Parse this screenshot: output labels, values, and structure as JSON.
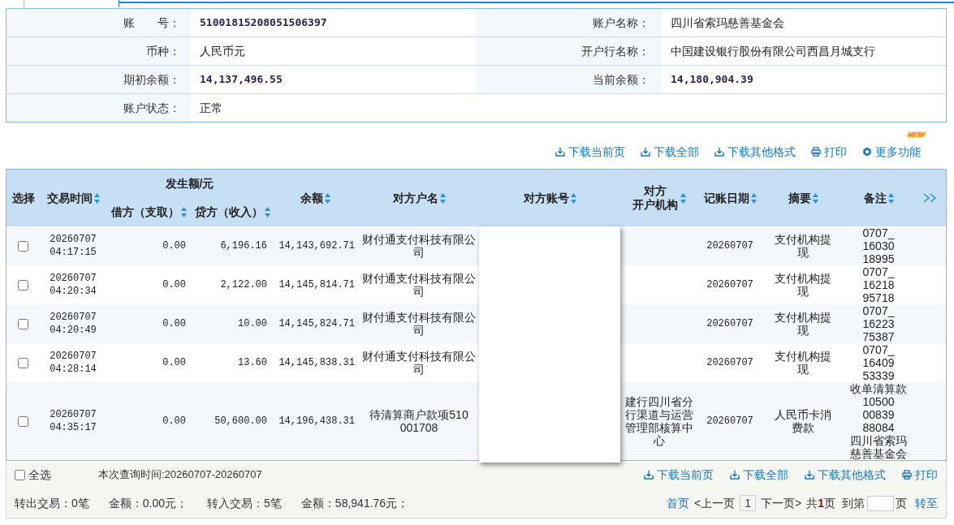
{
  "account_info": {
    "fields": [
      {
        "label": "账　　号：",
        "value": "51001815208051506397",
        "kind": "figure"
      },
      {
        "label": "账户名称：",
        "value": "四川省索玛慈善基金会",
        "kind": "text"
      },
      {
        "label": "币种：",
        "value": "人民币元",
        "kind": "text"
      },
      {
        "label": "开户行名称：",
        "value": "中国建设银行股份有限公司西昌月城支行",
        "kind": "text"
      },
      {
        "label": "期初余额：",
        "value": "14,137,496.55",
        "kind": "figure"
      },
      {
        "label": "当前余额：",
        "value": "14,180,904.39",
        "kind": "figure"
      },
      {
        "label": "账户状态：",
        "value": "正常",
        "kind": "text"
      }
    ]
  },
  "toolbar": {
    "actions": [
      {
        "kind": "download",
        "label": "下载当前页"
      },
      {
        "kind": "download",
        "label": "下载全部"
      },
      {
        "kind": "download",
        "label": "下载其他格式"
      },
      {
        "kind": "print",
        "label": "打印"
      },
      {
        "kind": "more",
        "label": "更多功能",
        "badge": "NEW"
      }
    ]
  },
  "table": {
    "columns": [
      {
        "label": "选择",
        "sortable": false
      },
      {
        "label": "交易时间",
        "sortable": true
      },
      {
        "label": "发生额/元",
        "sortable": false,
        "children": [
          {
            "label": "借方（支取）",
            "sortable": true
          },
          {
            "label": "贷方（收入）",
            "sortable": true
          }
        ]
      },
      {
        "label": "余额",
        "sortable": true
      },
      {
        "label": "对方户名",
        "sortable": true
      },
      {
        "label": "对方账号",
        "sortable": true
      },
      {
        "label": "对方开户机构",
        "sortable": true
      },
      {
        "label": "记账日期",
        "sortable": true
      },
      {
        "label": "摘要",
        "sortable": true
      },
      {
        "label": "备注",
        "sortable": true
      }
    ],
    "rows": [
      {
        "checked": false,
        "time": "20260707 04:17:15",
        "debit": "0.00",
        "credit": "6,196.16",
        "balance": "14,143,692.71",
        "counterparty_name": "财付通支付科技有限公司",
        "posting_date": "20260707",
        "summary": "支付机构提现",
        "remark": "0707_\n16030\n18995"
      },
      {
        "checked": false,
        "time": "20260707 04:20:34",
        "debit": "0.00",
        "credit": "2,122.00",
        "balance": "14,145,814.71",
        "counterparty_name": "财付通支付科技有限公司",
        "posting_date": "20260707",
        "summary": "支付机构提现",
        "remark": "0707_\n16218\n95718"
      },
      {
        "checked": false,
        "time": "20260707 04:20:49",
        "debit": "0.00",
        "credit": "10.00",
        "balance": "14,145,824.71",
        "counterparty_name": "财付通支付科技有限公司",
        "posting_date": "20260707",
        "summary": "支付机构提现",
        "remark": "0707_\n16223\n75387"
      },
      {
        "checked": false,
        "time": "20260707 04:28:14",
        "debit": "0.00",
        "credit": "13.60",
        "balance": "14,145,838.31",
        "counterparty_name": "财付通支付科技有限公司",
        "posting_date": "20260707",
        "summary": "支付机构提现",
        "remark": "0707_\n16409\n53339"
      },
      {
        "checked": false,
        "time": "20260707 04:35:17",
        "debit": "0.00",
        "credit": "50,600.00",
        "balance": "14,196,438.31",
        "counterparty_name": "待清算商户款项510\n001708",
        "counterparty_bank": "建行四川省分行渠道与运营管理部核算中心",
        "posting_date": "20260707",
        "summary": "人民币卡消费款",
        "remark": "收单清算款\n10500\n00839\n88084\n四川省索玛慈善基金会"
      }
    ]
  },
  "footer": {
    "select_all": {
      "label": "全选",
      "checked": false
    },
    "query_period": "本次查询时间:20260707-20260707",
    "actions": [
      {
        "kind": "download",
        "label": "下载当前页"
      },
      {
        "kind": "download",
        "label": "下载全部"
      },
      {
        "kind": "download",
        "label": "下载其他格式"
      },
      {
        "kind": "print",
        "label": "打印"
      }
    ],
    "totals": [
      "转出交易：0笔",
      "金额：0.00元；",
      "转入交易：5笔",
      "金额：58,941.76元；"
    ],
    "pagination": {
      "first": {
        "label": "首页",
        "disabled": false
      },
      "prev": {
        "label": "<上一页",
        "disabled": true
      },
      "pages": [
        {
          "label": "1",
          "selected": true
        }
      ],
      "next": {
        "label": "下一页>",
        "disabled": true
      },
      "total": "共**1**页",
      "goto_label": "到第",
      "goto_suffix": "页",
      "go": "转至"
    }
  }
}
